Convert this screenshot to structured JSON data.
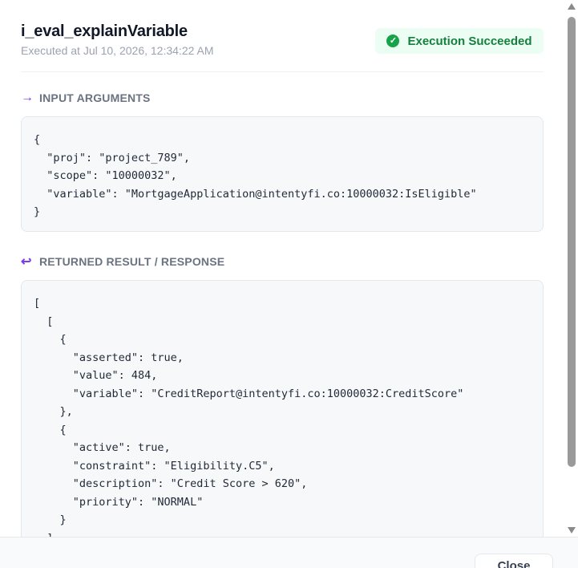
{
  "header": {
    "title": "i_eval_explainVariable",
    "executed_at": "Executed at Jul 10, 2026, 12:34:22 AM",
    "status": {
      "label": "Execution Succeeded",
      "color": "#15803d"
    }
  },
  "input": {
    "heading": "INPUT ARGUMENTS",
    "icon": "arrow-right-icon",
    "code": "{\n  \"proj\": \"project_789\",\n  \"scope\": \"10000032\",\n  \"variable\": \"MortgageApplication@intentyfi.co:10000032:IsEligible\"\n}"
  },
  "result": {
    "heading": "RETURNED RESULT / RESPONSE",
    "icon": "reply-icon",
    "code": "[\n  [\n    {\n      \"asserted\": true,\n      \"value\": 484,\n      \"variable\": \"CreditReport@intentyfi.co:10000032:CreditScore\"\n    },\n    {\n      \"active\": true,\n      \"constraint\": \"Eligibility.C5\",\n      \"description\": \"Credit Score > 620\",\n      \"priority\": \"NORMAL\"\n    }\n  ]\n]"
  },
  "footer": {
    "close_label": "Close"
  },
  "colors": {
    "accent": "#7c3aed",
    "success_bg": "#ecfdf3",
    "code_bg": "#f7f8fa"
  }
}
